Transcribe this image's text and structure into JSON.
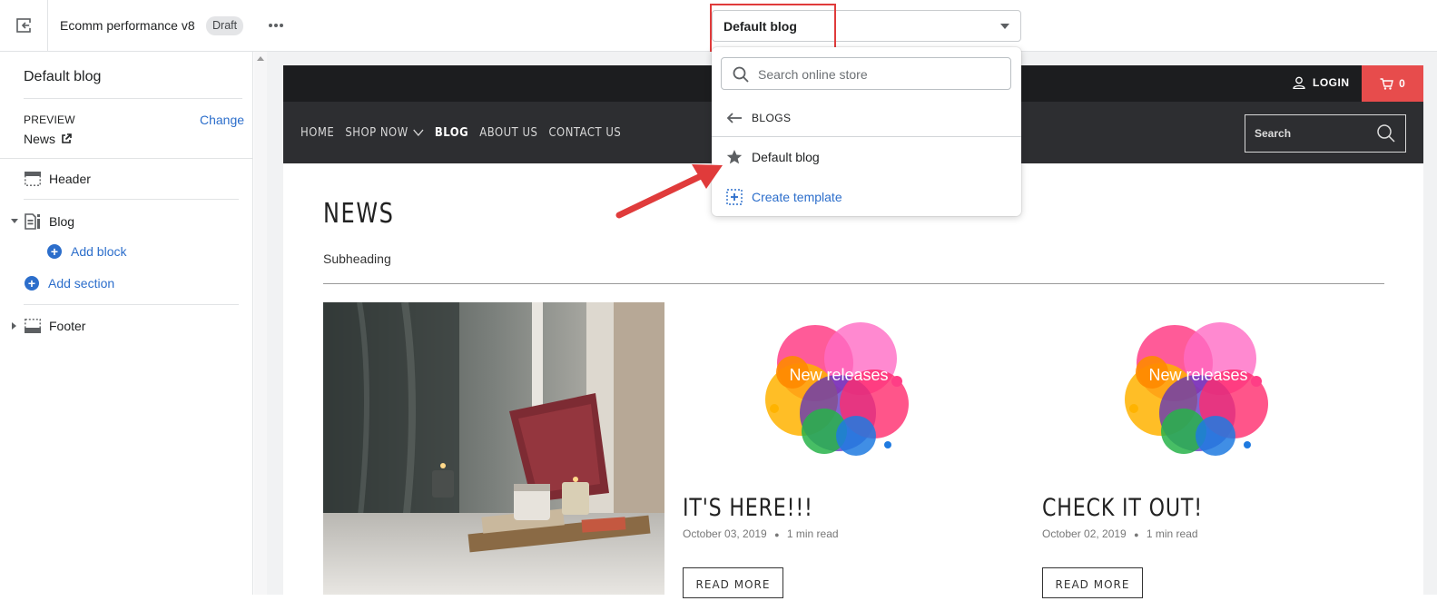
{
  "topbar": {
    "theme_name": "Ecomm performance v8",
    "badge": "Draft",
    "template_selected": "Default blog"
  },
  "sidebar": {
    "title": "Default blog",
    "preview_label": "PREVIEW",
    "preview_change": "Change",
    "preview_value": "News",
    "items": [
      {
        "label": "Header"
      },
      {
        "label": "Blog"
      },
      {
        "label": "Add block"
      },
      {
        "label": "Add section"
      },
      {
        "label": "Footer"
      }
    ]
  },
  "dropdown": {
    "search_placeholder": "Search online store",
    "back_label": "BLOGS",
    "item": "Default blog",
    "create": "Create template"
  },
  "store": {
    "login": "LOGIN",
    "cart_count": "0",
    "nav": [
      "HOME",
      "SHOP NOW",
      "BLOG",
      "ABOUT US",
      "CONTACT US"
    ],
    "search_placeholder": "Search",
    "heading": "NEWS",
    "subheading": "Subheading",
    "posts": [
      {
        "image_text": "New releases",
        "title": "IT'S HERE!!!",
        "date": "October 03, 2019",
        "read_time": "1 min read",
        "button": "READ MORE"
      },
      {
        "image_text": "New releases",
        "title": "CHECK IT OUT!",
        "date": "October 02, 2019",
        "read_time": "1 min read",
        "button": "READ MORE"
      }
    ]
  },
  "colors": {
    "accent": "#2c6ecb",
    "annotation": "#e03b3b",
    "cart": "#e74c4c",
    "store_nav": "#2d2e31"
  }
}
